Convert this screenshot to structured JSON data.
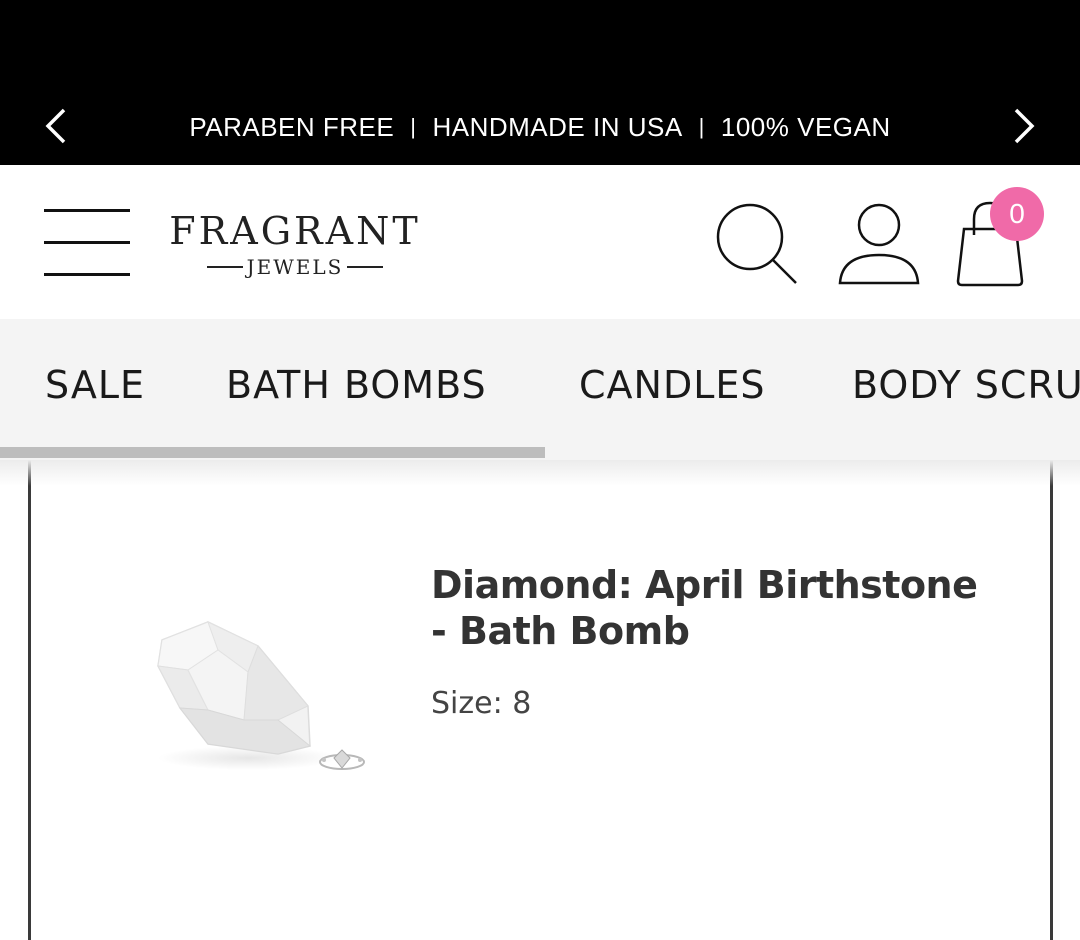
{
  "announcement": {
    "messages": [
      "PARABEN FREE",
      "HANDMADE IN USA",
      "100% VEGAN"
    ],
    "separator": "|",
    "prev_icon": "chevron-left-icon",
    "next_icon": "chevron-right-icon"
  },
  "header": {
    "menu_icon": "hamburger-menu-icon",
    "logo_main": "FRAGRANT",
    "logo_sub": "JEWELS",
    "search_icon": "search-icon",
    "account_icon": "user-icon",
    "cart_icon": "shopping-bag-icon",
    "cart_count": "0",
    "badge_color": "#f06aa8"
  },
  "categories": [
    {
      "label": "SALE"
    },
    {
      "label": "BATH BOMBS"
    },
    {
      "label": "CANDLES"
    },
    {
      "label": "BODY SCRU"
    }
  ],
  "product": {
    "title": "Diamond: April Birthstone - Bath Bomb",
    "size_label": "Size: 8",
    "image_icon": "diamond-bath-bomb-image"
  }
}
